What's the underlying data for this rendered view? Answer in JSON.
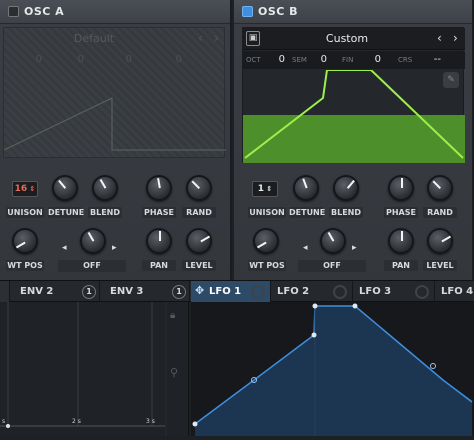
{
  "osc_a": {
    "title": "OSC  A",
    "preset_name": "Default",
    "pitch": [
      {
        "label": "",
        "value": "0"
      },
      {
        "label": "",
        "value": "0"
      },
      {
        "label": "",
        "value": "0"
      },
      {
        "label": "",
        "value": "0"
      }
    ],
    "unison_value": "16",
    "labels": {
      "unison": "UNISON",
      "detune": "DETUNE",
      "blend": "BLEND",
      "phase": "PHASE",
      "rand": "RAND",
      "wtpos": "WT POS",
      "off": "OFF",
      "pan": "PAN",
      "level": "LEVEL"
    }
  },
  "osc_b": {
    "title": "OSC  B",
    "preset_name": "Custom",
    "pitch": [
      {
        "label": "OCT",
        "value": "0"
      },
      {
        "label": "SEM",
        "value": "0"
      },
      {
        "label": "FIN",
        "value": "0"
      },
      {
        "label": "CRS",
        "value": "--"
      }
    ],
    "unison_value": "1",
    "labels": {
      "unison": "UNISON",
      "detune": "DETUNE",
      "blend": "BLEND",
      "phase": "PHASE",
      "rand": "RAND",
      "wtpos": "WT POS",
      "off": "OFF",
      "pan": "PAN",
      "level": "LEVEL"
    }
  },
  "tabs": [
    {
      "label": "ENV 2",
      "badge": "1"
    },
    {
      "label": "ENV 3",
      "badge": "1"
    },
    {
      "label": "LFO 1",
      "badge": ""
    },
    {
      "label": "LFO 2",
      "badge": ""
    },
    {
      "label": "LFO 3",
      "badge": ""
    },
    {
      "label": "LFO 4",
      "badge": ""
    }
  ],
  "env_ticks": [
    "s",
    "2 s",
    "3 s"
  ],
  "icons": {
    "save": "save-icon",
    "prev": "chevron-left-icon",
    "next": "chevron-right-icon",
    "move": "move-icon",
    "lock": "lock-icon",
    "zoom": "zoom-icon",
    "edit": "pencil-icon"
  },
  "colors": {
    "accent": "#3d8fe0",
    "wave_green": "#7bd93a",
    "lfo_blue": "#3f8fe0",
    "unison_red": "#e56a5c"
  }
}
